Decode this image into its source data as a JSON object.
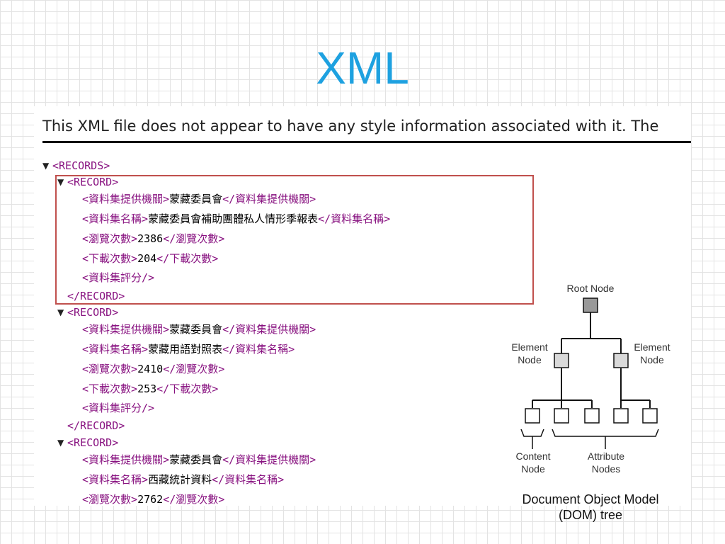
{
  "slide": {
    "title": "XML",
    "caption_line1": "Document Object Model",
    "caption_line2": "(DOM) tree"
  },
  "xml_view": {
    "notice": "This XML file does not appear to have any style information associated with it. The",
    "records_open": "<RECORDS>",
    "record_open": "<RECORD>",
    "record_close": "</RECORD>",
    "highlight_color": "#c0504d",
    "tag_color": "#881280",
    "collapse_icon": "triangle-down-icon",
    "records": [
      {
        "provider": {
          "open": "<資料集提供機關>",
          "value": "蒙藏委員會",
          "close": "</資料集提供機關>"
        },
        "name": {
          "open": "<資料集名稱>",
          "value": "蒙藏委員會補助團體私人情形季報表",
          "close": "</資料集名稱>"
        },
        "views": {
          "open": "<瀏覽次數>",
          "value": "2386",
          "close": "</瀏覽次數>"
        },
        "downloads": {
          "open": "<下載次數>",
          "value": "204",
          "close": "</下載次數>"
        },
        "rating": "<資料集評分/>"
      },
      {
        "provider": {
          "open": "<資料集提供機關>",
          "value": "蒙藏委員會",
          "close": "</資料集提供機關>"
        },
        "name": {
          "open": "<資料集名稱>",
          "value": "蒙藏用語對照表",
          "close": "</資料集名稱>"
        },
        "views": {
          "open": "<瀏覽次數>",
          "value": "2410",
          "close": "</瀏覽次數>"
        },
        "downloads": {
          "open": "<下載次數>",
          "value": "253",
          "close": "</下載次數>"
        },
        "rating": "<資料集評分/>"
      },
      {
        "provider": {
          "open": "<資料集提供機關>",
          "value": "蒙藏委員會",
          "close": "</資料集提供機關>"
        },
        "name": {
          "open": "<資料集名稱>",
          "value": "西藏統計資料",
          "close": "</資料集名稱>"
        },
        "views": {
          "open": "<瀏覽次數>",
          "value": "2762",
          "close": "</瀏覽次數>"
        }
      }
    ]
  },
  "dom_tree": {
    "root_label": "Root Node",
    "element_left_label": "Element Node",
    "element_right_label": "Element Node",
    "content_label": "Content Node",
    "attribute_label": "Attribute Nodes",
    "root_color": "#999999",
    "element_color": "#d9d9d9"
  }
}
